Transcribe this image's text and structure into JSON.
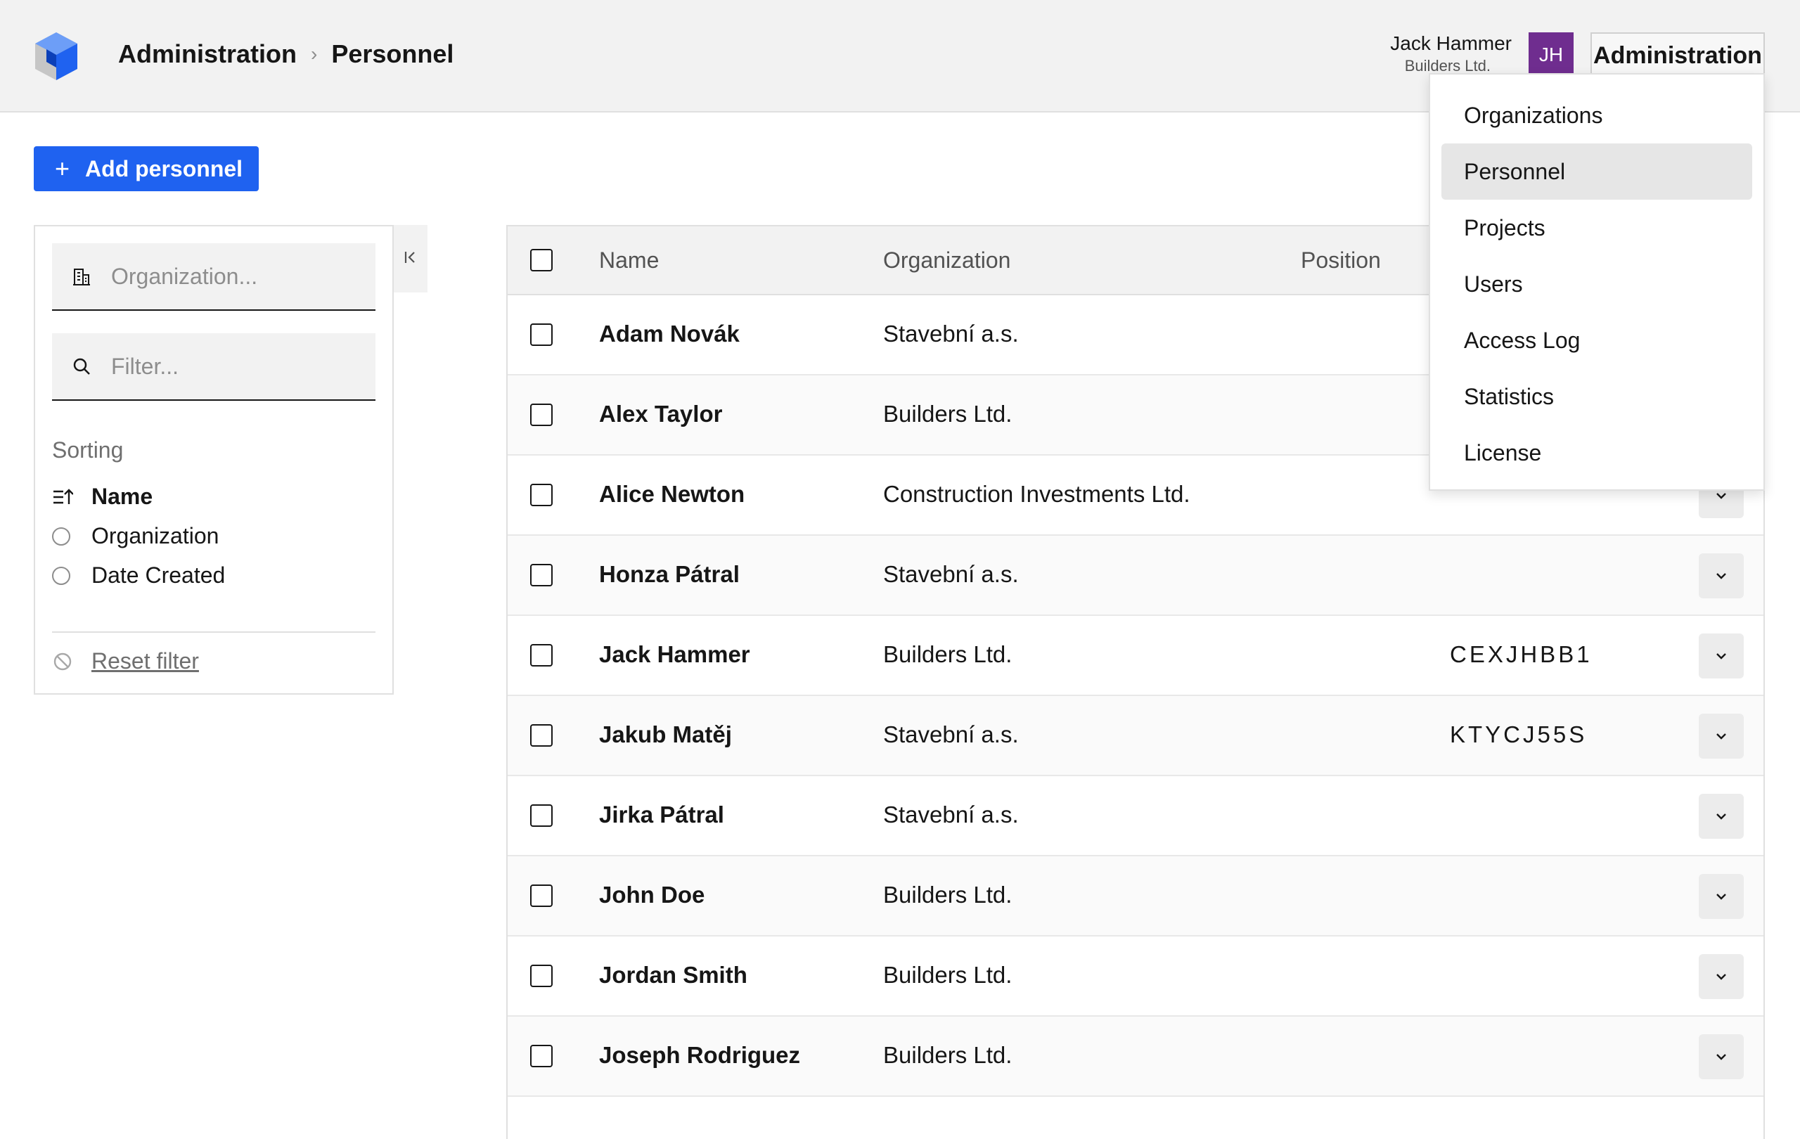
{
  "header": {
    "breadcrumb": [
      "Administration",
      "Personnel"
    ],
    "user": {
      "name": "Jack Hammer",
      "org": "Builders Ltd.",
      "initials": "JH"
    },
    "admin_label": "Administration",
    "avatar_color": "#6f2d8f"
  },
  "dropdown": {
    "items": [
      {
        "label": "Organizations",
        "active": false
      },
      {
        "label": "Personnel",
        "active": true
      },
      {
        "label": "Projects",
        "active": false
      },
      {
        "label": "Users",
        "active": false
      },
      {
        "label": "Access Log",
        "active": false
      },
      {
        "label": "Statistics",
        "active": false
      },
      {
        "label": "License",
        "active": false
      }
    ]
  },
  "toolbar": {
    "add_label": "Add personnel",
    "accent": "#1f62f0"
  },
  "sidebar": {
    "org_placeholder": "Organization...",
    "filter_placeholder": "Filter...",
    "sorting_title": "Sorting",
    "sort_options": [
      {
        "label": "Name",
        "selected": true
      },
      {
        "label": "Organization",
        "selected": false
      },
      {
        "label": "Date Created",
        "selected": false
      }
    ],
    "reset_label": "Reset filter"
  },
  "table": {
    "columns": [
      "Name",
      "Organization",
      "Position"
    ],
    "rows": [
      {
        "name": "Adam Novák",
        "org": "Stavební a.s.",
        "code": ""
      },
      {
        "name": "Alex Taylor",
        "org": "Builders Ltd.",
        "code": ""
      },
      {
        "name": "Alice Newton",
        "org": "Construction Investments Ltd.",
        "code": ""
      },
      {
        "name": "Honza Pátral",
        "org": "Stavební a.s.",
        "code": ""
      },
      {
        "name": "Jack Hammer",
        "org": "Builders Ltd.",
        "code": "CEXJHBB1"
      },
      {
        "name": "Jakub Matěj",
        "org": "Stavební a.s.",
        "code": "KTYCJ55S"
      },
      {
        "name": "Jirka Pátral",
        "org": "Stavební a.s.",
        "code": ""
      },
      {
        "name": "John Doe",
        "org": "Builders Ltd.",
        "code": ""
      },
      {
        "name": "Jordan Smith",
        "org": "Builders Ltd.",
        "code": ""
      },
      {
        "name": "Joseph Rodriguez",
        "org": "Builders Ltd.",
        "code": ""
      }
    ]
  }
}
